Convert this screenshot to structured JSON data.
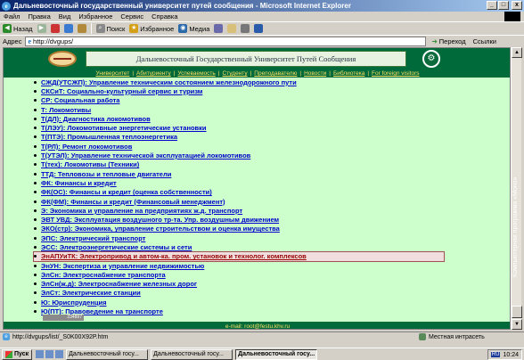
{
  "window": {
    "title": "Дальневосточный государственный университет путей сообщения - Microsoft Internet Explorer",
    "ie_glyph": "e",
    "min_glyph": "_",
    "max_glyph": "□",
    "close_glyph": "x"
  },
  "menu": [
    "Файл",
    "Правка",
    "Вид",
    "Избранное",
    "Сервис",
    "Справка"
  ],
  "toolbar": {
    "back": "Назад",
    "search": "Поиск",
    "favorites": "Избранное",
    "media": "Медиа",
    "back_glyph": "◀",
    "forward_glyph": "▶",
    "search_glyph": "⌕",
    "favorites_glyph": "★",
    "media_glyph": "◉"
  },
  "address": {
    "label": "Адрес",
    "url": "http://dvgups/",
    "go": "Переход",
    "links": "Ссылки",
    "e_glyph": "e",
    "go_glyph": "➔"
  },
  "header": {
    "banner_text": "Дальневосточный Государственный Университет Путей Сообщения",
    "emblem_glyph": "⚙"
  },
  "nav": [
    "Университет",
    "Абитуриенту",
    "Успеваемость",
    "Студенту",
    "Преподавателю",
    "Новости",
    "Библиотека",
    "For foreign visitors"
  ],
  "items": [
    "СЖД(УТСЖП): Управление техническим состоянием железнодорожного пути",
    "СКСиТ: Социально-культурный сервис и туризм",
    "СР: Социальная работа",
    "Т: Локомотивы",
    "Т(ДЛ): Диагностика локомотивов",
    "Т(ЛЭУ): Локомотивные энергетические установки",
    "Т(ПТЭ): Промышленная теплоэнергетика",
    "Т(РЛ): Ремонт локомотивов",
    "Т(УТЭЛ): Управление технической эксплуатацией локомотивов",
    "Т(тех): Локомотивы (Техники)",
    "ТТД: Тепловозы и тепловые двигатели",
    "ФК: Финансы и кредит",
    "ФК(ОС): Финансы и кредит (оценка собственности)",
    "ФК(ФМ): Финансы и кредит (Финансовый менеджмент)",
    "Э: Экономика и управление на предприятиях ж.д. транспорт",
    "ЭВТ УВД: Эксплуатация воздушного тр-та. Упр. воздушным движением",
    "ЭКО(стр): Экономика, управление строительством и оценка имущества",
    "ЭПС: Электрический транспорт",
    "ЭСС: Электроэнергетические системы и сети",
    "ЭнАПУиТК: Электропривод и автом-ка. пром. установок и технолог. комплексов",
    "ЭнУН: Экспертиза и управление недвижимостью",
    "ЭлСн: Электроснабжение транспорта",
    "ЭлСн(ж.д): Электроснабжение железных дорог",
    "ЭлСт: Электрические станции",
    "Ю: Юриспруденция",
    "Ю(ПТ): Правоведение на транспорте"
  ],
  "hovered_index": 19,
  "counter": "234897",
  "footer": "e-mail: root@festu.khv.ru",
  "status": {
    "url": "http://dvgups/list/_S0K00X92P.htm",
    "zone": "Местная интрасеть"
  },
  "taskbar": {
    "start": "Пуск",
    "tasks": [
      "Дальневосточный госу...",
      "Дальневосточный госу...",
      "Дальневосточный госу..."
    ],
    "active_task": 2,
    "lang": "RU",
    "clock": "10:24"
  },
  "side_text": "Компьютерная программа «Моно»"
}
